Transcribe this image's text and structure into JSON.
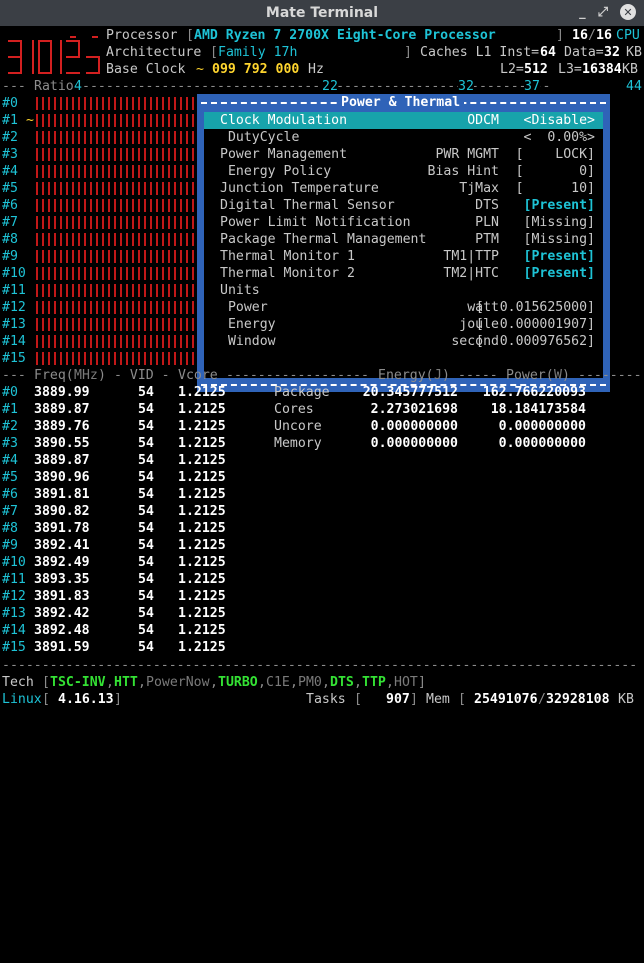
{
  "window": {
    "title": "Mate Terminal",
    "minimize": "_",
    "restore": "⤢",
    "close": "✕"
  },
  "header": {
    "processor_label": "Processor",
    "processor_value": "AMD Ryzen 7 2700X Eight-Core Processor",
    "cpu_count": "16",
    "cpu_total": "16",
    "cpu_suffix": "CPU",
    "arch_label": "Architecture",
    "arch_value": "Family 17h",
    "caches_label": "Caches L1 Inst=",
    "l1_inst": "64",
    "l1_data_label": "Data=",
    "l1_data": "32",
    "kb": "KB",
    "base_clock_label": "Base Clock",
    "base_clock_tilde": "~",
    "base_clock_value": "099 792 000",
    "hz": "Hz",
    "l2_label": "L2=",
    "l2": "512",
    "l3_label": "L3=",
    "l3": "16384",
    "ratio_label": "Ratio",
    "ratio_ticks": [
      "4",
      "22",
      "32",
      "37",
      "44"
    ]
  },
  "cores": [
    {
      "id": "#0",
      "freq": "3889.99",
      "vid": "54",
      "vcore": "1.2125",
      "mark": ""
    },
    {
      "id": "#1",
      "freq": "3889.87",
      "vid": "54",
      "vcore": "1.2125",
      "mark": "~"
    },
    {
      "id": "#2",
      "freq": "3889.76",
      "vid": "54",
      "vcore": "1.2125",
      "mark": ""
    },
    {
      "id": "#3",
      "freq": "3890.55",
      "vid": "54",
      "vcore": "1.2125",
      "mark": ""
    },
    {
      "id": "#4",
      "freq": "3889.87",
      "vid": "54",
      "vcore": "1.2125",
      "mark": ""
    },
    {
      "id": "#5",
      "freq": "3890.96",
      "vid": "54",
      "vcore": "1.2125",
      "mark": ""
    },
    {
      "id": "#6",
      "freq": "3891.81",
      "vid": "54",
      "vcore": "1.2125",
      "mark": ""
    },
    {
      "id": "#7",
      "freq": "3890.82",
      "vid": "54",
      "vcore": "1.2125",
      "mark": ""
    },
    {
      "id": "#8",
      "freq": "3891.78",
      "vid": "54",
      "vcore": "1.2125",
      "mark": ""
    },
    {
      "id": "#9",
      "freq": "3892.41",
      "vid": "54",
      "vcore": "1.2125",
      "mark": ""
    },
    {
      "id": "#10",
      "freq": "3892.49",
      "vid": "54",
      "vcore": "1.2125",
      "mark": ""
    },
    {
      "id": "#11",
      "freq": "3893.35",
      "vid": "54",
      "vcore": "1.2125",
      "mark": ""
    },
    {
      "id": "#12",
      "freq": "3891.83",
      "vid": "54",
      "vcore": "1.2125",
      "mark": ""
    },
    {
      "id": "#13",
      "freq": "3892.42",
      "vid": "54",
      "vcore": "1.2125",
      "mark": ""
    },
    {
      "id": "#14",
      "freq": "3892.48",
      "vid": "54",
      "vcore": "1.2125",
      "mark": ""
    },
    {
      "id": "#15",
      "freq": "3891.59",
      "vid": "54",
      "vcore": "1.2125",
      "mark": ""
    }
  ],
  "popup": {
    "title": "Power & Thermal",
    "rows": [
      {
        "label": "Clock Modulation",
        "key": "ODCM",
        "value": "<Disable>",
        "selected": true
      },
      {
        "label": " DutyCycle",
        "key": "",
        "value": "<  0.00%>"
      },
      {
        "label": "Power Management",
        "key": "PWR MGMT",
        "value": "[    LOCK]"
      },
      {
        "label": " Energy Policy",
        "key": "Bias Hint",
        "value": "[       0]"
      },
      {
        "label": "Junction Temperature",
        "key": "TjMax",
        "value": "[      10]"
      },
      {
        "label": "Digital Thermal Sensor",
        "key": "DTS",
        "value": "[Present]",
        "bright": true
      },
      {
        "label": "Power Limit Notification",
        "key": "PLN",
        "value": "[Missing]"
      },
      {
        "label": "Package Thermal Management",
        "key": "PTM",
        "value": "[Missing]"
      },
      {
        "label": "Thermal Monitor 1",
        "key": "TM1|TTP",
        "value": "[Present]",
        "bright": true
      },
      {
        "label": "Thermal Monitor 2",
        "key": "TM2|HTC",
        "value": "[Present]",
        "bright": true
      },
      {
        "label": "Units",
        "key": "",
        "value": ""
      },
      {
        "label": " Power",
        "key": "watt",
        "value": "[  0.015625000]"
      },
      {
        "label": " Energy",
        "key": "joule",
        "value": "[  0.000001907]"
      },
      {
        "label": " Window",
        "key": "second",
        "value": "[  0.000976562]"
      }
    ]
  },
  "table_header": {
    "lead": "---",
    "freq": "Freq(",
    "mhz": "MHz",
    "freq_close": ")",
    "vid": "- VID -",
    "vcore": "Vcore",
    "energy": "Energy(",
    "j": "J",
    "energy_close": ")",
    "power": "Power(",
    "w": "W",
    "power_close": ")"
  },
  "energy": [
    {
      "label": "Package",
      "energy": "20.345777512",
      "power": "162.766220093"
    },
    {
      "label": "Cores",
      "energy": "2.273021698",
      "power": "18.184173584"
    },
    {
      "label": "Uncore",
      "energy": "0.000000000",
      "power": "0.000000000"
    },
    {
      "label": "Memory",
      "energy": "0.000000000",
      "power": "0.000000000"
    }
  ],
  "tech": {
    "label": "Tech",
    "open": "[",
    "close": "]",
    "items": [
      {
        "name": "TSC-INV",
        "on": true
      },
      {
        "name": "HTT",
        "on": true
      },
      {
        "name": "PowerNow",
        "on": false
      },
      {
        "name": "TURBO",
        "on": true
      },
      {
        "name": "C1E",
        "on": false
      },
      {
        "name": "PM0",
        "on": false
      },
      {
        "name": "DTS",
        "on": true
      },
      {
        "name": "TTP",
        "on": true
      },
      {
        "name": "HOT",
        "on": false
      }
    ]
  },
  "status": {
    "os": "Linux",
    "kernel": "4.16.13",
    "tasks_label": "Tasks",
    "tasks": "907",
    "mem_label": "Mem",
    "mem_used": "25491076",
    "mem_total": "32928108",
    "mem_unit": "KB"
  }
}
